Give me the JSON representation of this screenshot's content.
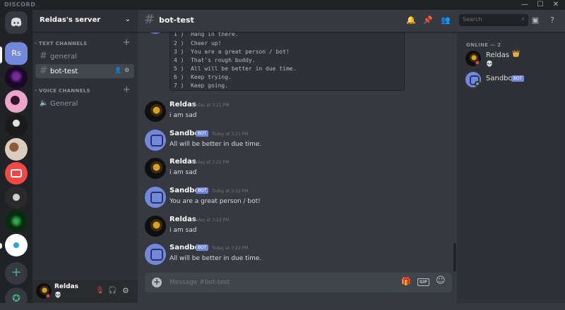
{
  "app": {
    "brand": "DISCORD",
    "controls": {
      "minimize": "—",
      "maximize": "☐",
      "close": "✕"
    }
  },
  "guild_icons": [
    {
      "name": "home",
      "color": "#36393f"
    },
    {
      "name": "server-rs",
      "label": "Rs",
      "color": "#7289da"
    },
    {
      "name": "guild-3",
      "color": "#2b0a3d"
    },
    {
      "name": "guild-4",
      "color": "#e8a7c9"
    },
    {
      "name": "guild-5",
      "color": "#1a1a1a"
    },
    {
      "name": "guild-6",
      "color": "#cfc4b5"
    },
    {
      "name": "guild-7",
      "color": "#f04747"
    },
    {
      "name": "guild-8",
      "color": "#2a2a2a"
    },
    {
      "name": "guild-9",
      "color": "#0f3d1a"
    },
    {
      "name": "guild-10",
      "color": "#ffffff"
    }
  ],
  "server": {
    "name": "Reldas's server"
  },
  "sidebar": {
    "text_category": "TEXT CHANNELS",
    "voice_category": "VOICE CHANNELS",
    "text_channels": [
      {
        "name": "general"
      },
      {
        "name": "bot-test"
      }
    ],
    "voice_channels": [
      {
        "name": "General"
      }
    ]
  },
  "user_panel": {
    "username": "Reldas",
    "status": "💀"
  },
  "channel": {
    "name": "bot-test",
    "search_placeholder": "Search"
  },
  "code_lines": [
    "1 )  Hang in there.",
    "2 )  Cheer up!",
    "3 )  You are a great person / bot!",
    "4 )  That's rough buddy.",
    "5 )  All will be better in due time.",
    "6 )  Keep trying.",
    "7 )  Keep going."
  ],
  "messages": [
    {
      "author": "Reldas",
      "bot": false,
      "timestamp": "Today at 3:21 PM",
      "text": "i am sad"
    },
    {
      "author": "Sandbot",
      "bot": true,
      "badge": "BOT",
      "timestamp": "Today at 3:21 PM",
      "text": "All will be better in due time."
    },
    {
      "author": "Reldas",
      "bot": false,
      "timestamp": "Today at 3:22 PM",
      "text": "i am sad"
    },
    {
      "author": "Sandbot",
      "bot": true,
      "badge": "BOT",
      "timestamp": "Today at 3:22 PM",
      "text": "You are a great person / bot!"
    },
    {
      "author": "Reldas",
      "bot": false,
      "timestamp": "Today at 3:22 PM",
      "text": "i am sad"
    },
    {
      "author": "Sandbot",
      "bot": true,
      "badge": "BOT",
      "timestamp": "Today at 3:22 PM",
      "text": "All will be better in due time."
    }
  ],
  "composer": {
    "placeholder": "Message #bot-test",
    "gif_label": "GIF"
  },
  "members": {
    "header": "ONLINE — 2",
    "list": [
      {
        "name": "Reldas",
        "crown": "👑",
        "status_text": "💀",
        "color": "#b9bbbe"
      },
      {
        "name": "Sandbot",
        "badge": "BOT",
        "color": "#b9bbbe"
      }
    ]
  }
}
